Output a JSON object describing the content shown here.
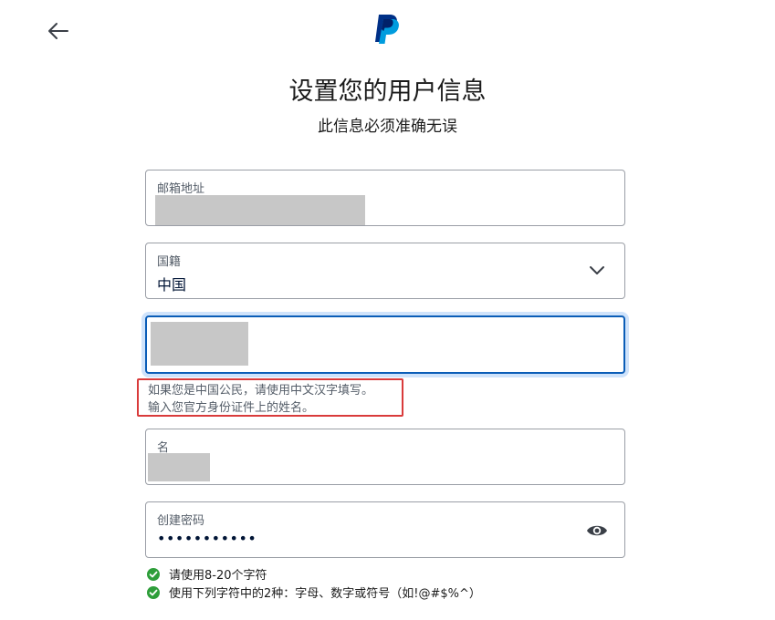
{
  "header": {
    "back_icon": "arrow-left-icon",
    "logo_icon": "paypal-logo-icon",
    "brand_color": "#003087"
  },
  "page": {
    "title": "设置您的用户信息",
    "subtitle": "此信息必须准确无误"
  },
  "form": {
    "email": {
      "label": "邮箱地址",
      "value_redacted": true
    },
    "country": {
      "label": "国籍",
      "value": "中国",
      "icon": "chevron-down-icon"
    },
    "surname": {
      "value_redacted": true,
      "state": "focused"
    },
    "surname_hint": {
      "line1": "如果您是中国公民，请使用中文汉字填写。",
      "line2": "输入您官方身份证件上的姓名。"
    },
    "given_name": {
      "label": "名",
      "value_redacted": true
    },
    "password": {
      "label": "创建密码",
      "masked_value": "•••••••••••",
      "icon": "eye-icon"
    }
  },
  "requirements": [
    {
      "text": "请使用8-20个字符",
      "status": "met",
      "icon": "check-circle-icon"
    },
    {
      "text": "使用下列字符中的2种：字母、数字或符号（如!@#$%^）",
      "status": "met",
      "icon": "check-circle-icon"
    }
  ],
  "colors": {
    "focus_border": "#0a5db7",
    "focus_ring": "#cfe3fb",
    "highlight_box": "#d93b3b",
    "check_green": "#2e9e3a"
  }
}
